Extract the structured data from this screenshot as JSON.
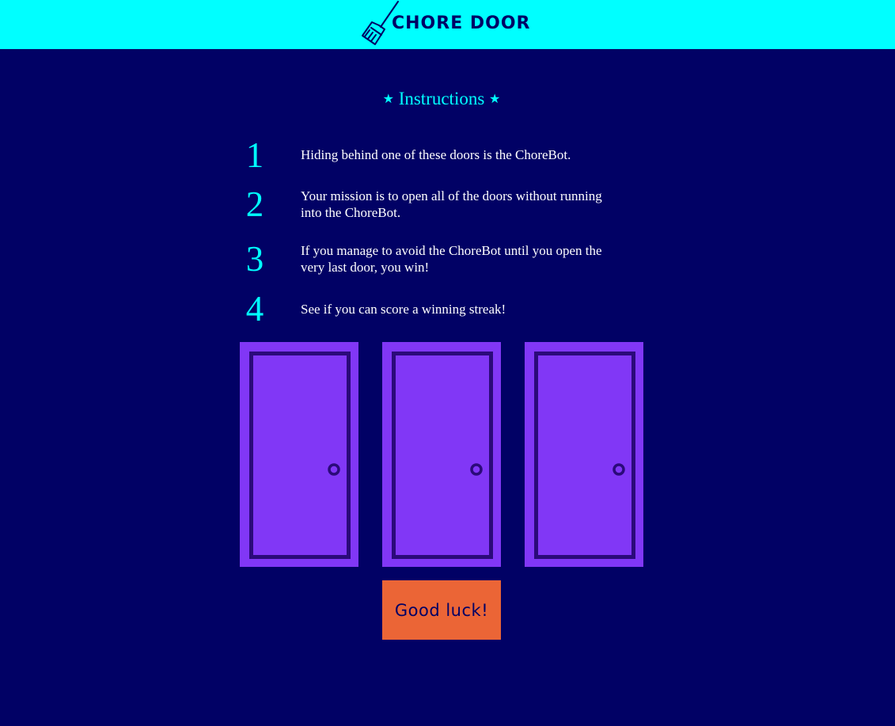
{
  "header": {
    "title": "CHORE DOOR",
    "logo_icon": "broom-icon"
  },
  "instructions": {
    "title": "Instructions",
    "star": "★",
    "steps": [
      {
        "number": "1",
        "text": "Hiding behind one of these doors is the ChoreBot."
      },
      {
        "number": "2",
        "text": "Your mission is to open all of the doors without running into the ChoreBot."
      },
      {
        "number": "3",
        "text": "If you manage to avoid the ChoreBot until you open the very last door, you win!"
      },
      {
        "number": "4",
        "text": "See if you can score a winning streak!"
      }
    ]
  },
  "doors": [
    {
      "icon": "closed-door-icon"
    },
    {
      "icon": "closed-door-icon"
    },
    {
      "icon": "closed-door-icon"
    }
  ],
  "start_button": {
    "label": "Good luck!"
  },
  "colors": {
    "background": "#010165",
    "header": "#00ffff",
    "accent": "#00ffff",
    "door": "#8137f6",
    "door_outline": "#2b0a7a",
    "button": "#eb6536",
    "text": "#ffffff"
  }
}
